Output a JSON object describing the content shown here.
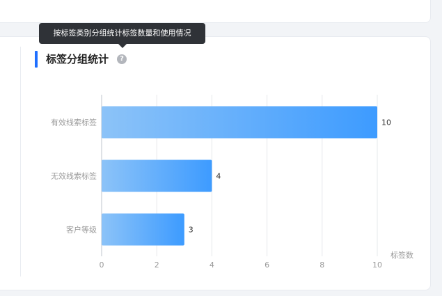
{
  "tooltip": {
    "text": "按标签类别分组统计标签数量和使用情况"
  },
  "panel": {
    "title": "标签分组统计",
    "help_icon": "question-circle-icon"
  },
  "chart_data": {
    "type": "bar",
    "orientation": "horizontal",
    "categories": [
      "有效线索标签",
      "无效线索标签",
      "客户等级"
    ],
    "values": [
      10,
      4,
      3
    ],
    "xlabel": "标签数",
    "xlim": [
      0,
      10
    ],
    "xticks": [
      0,
      2,
      4,
      6,
      8,
      10
    ],
    "grid": true,
    "colors": {
      "bar_start": "#8cc3f8",
      "bar_end": "#3d9bff"
    }
  }
}
